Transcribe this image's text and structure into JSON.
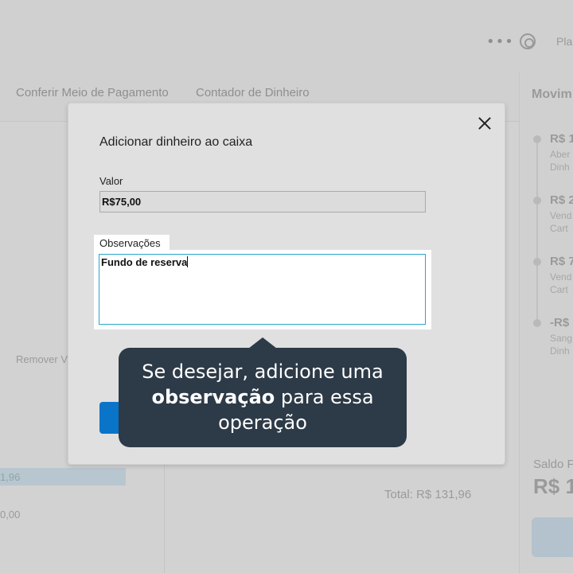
{
  "header": {
    "more_icon": "more-dots-icon",
    "help_icon": "lifebuoy-icon",
    "user_label": "Plan"
  },
  "tabs": [
    {
      "label": "Conferir Meio de Pagamento"
    },
    {
      "label": "Contador de Dinheiro"
    }
  ],
  "table": {
    "remove_label": "Remover V",
    "bar_value": "1,96",
    "zero_value": "0,00",
    "total_label": "Total: R$ 131,96"
  },
  "movements": {
    "title": "Movim",
    "items": [
      {
        "amount": "R$ 1",
        "line1": "Aber",
        "line2": "Dinh"
      },
      {
        "amount": "R$ 2",
        "line1": "Vend",
        "line2": "Cart"
      },
      {
        "amount": "R$ 7",
        "line1": "Vend",
        "line2": "Cart"
      },
      {
        "amount": "-R$",
        "line1": "Sang",
        "line2": "Dinh"
      }
    ],
    "saldo_label": "Saldo F",
    "saldo_value": "R$ 1"
  },
  "modal": {
    "title": "Adicionar dinheiro ao caixa",
    "valor_label": "Valor",
    "valor_value": "R$75,00",
    "obs_label": "Observações",
    "obs_value": "Fundo de reserva"
  },
  "tooltip": {
    "line1": "Se desejar, adicione uma",
    "bold": "observação",
    "line2_rest": " para essa",
    "line3": "operação"
  },
  "colors": {
    "accent": "#0a74c9",
    "tooltip_bg": "#2d3a47",
    "focus_border": "#2aa7c9"
  }
}
